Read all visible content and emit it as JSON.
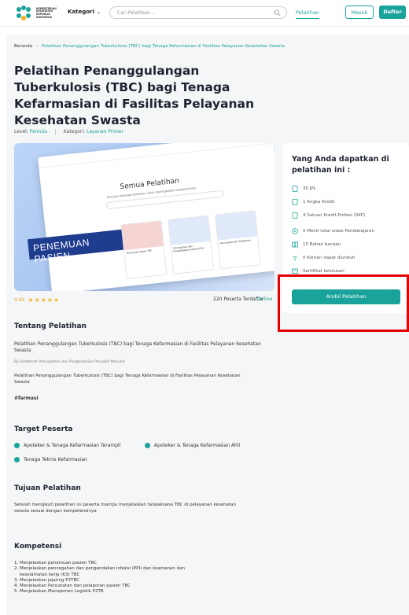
{
  "header": {
    "logo_text": "KEMENTERIAN KESEHATAN REPUBLIK INDONESIA",
    "kategori": "Kategori",
    "search_placeholder": "Cari Pelatihan...",
    "nav_pelatihan": "Pelatihan",
    "btn_masuk": "Masuk",
    "btn_daftar": "Daftar"
  },
  "breadcrumb": {
    "home": "Beranda",
    "sep": "›",
    "current": "Pelatihan Penanggulangan Tuberkulosis (TBC) bagi Tenaga Kefarmasian di Fasilitas Pelayanan Kesehatan Swasta"
  },
  "course": {
    "title": "Pelatihan Penanggulangan Tuberkulosis (TBC) bagi Tenaga Kefarmasian di Fasilitas Pelayanan Kesehatan Swasta",
    "level_label": "Level:",
    "level_value": "Pemula",
    "kategori_label": "Kategori:",
    "kategori_value": "Layanan Primer",
    "rating": "4.95",
    "stars": 4.95,
    "peserta": "220 Peserta Terdaftar",
    "mode": "Online"
  },
  "hero": {
    "screen_title": "Semua Pelatihan",
    "screen_sub": "Temukan berbagai pelatihan untuk meningkatkan kompetensimu",
    "banner": "PENEMUAN PASIEN",
    "cards": [
      "Penemuan Pasien TBC",
      "Pencegahan dan Pengendalian Infeksi (PPI)",
      "Pencatatan dan Pelaporan"
    ]
  },
  "side": {
    "heading": "Yang Anda dapatkan di pelatihan ini :",
    "items": [
      {
        "icon": "document-icon",
        "text": "30 JPL"
      },
      {
        "icon": "document-icon",
        "text": "1 Angka Kredit"
      },
      {
        "icon": "document-icon",
        "text": "4 Satuan Kredit Profesi (SKP)"
      },
      {
        "icon": "play-icon",
        "text": "0 Menit total video Pembelajaran"
      },
      {
        "icon": "book-icon",
        "text": "15 Bahan bacaan"
      },
      {
        "icon": "download-icon",
        "text": "0 Konten dapat diunduh"
      },
      {
        "icon": "certificate-icon",
        "text": "Sertifikat kelulusan"
      }
    ],
    "button": "Ambil Pelatihan"
  },
  "tentang": {
    "heading": "Tentang Pelatihan",
    "title": "Pelatihan Penanggulangan Tuberkulosis (TBC) bagi Tenaga Kefarmasian di Fasilitas Pelayanan Kesehatan Swasta",
    "by": "By Direktorat Pencegahan dan Pengendalian Penyakit Menular",
    "desc": "Pelatihan Penanggulangan Tuberkulosis (TBC) bagi Tenaga Kefarmasian di Fasilitas Pelayanan Kesehatan Swasta",
    "tag": "#farmasi"
  },
  "target": {
    "heading": "Target Peserta",
    "items": [
      "Apoteker & Tenaga Kefarmasian Terampil",
      "Apoteker & Tenaga Kefarmasian Ahli",
      "Tenaga Teknis Kefarmasian"
    ]
  },
  "tujuan": {
    "heading": "Tujuan Pelatihan",
    "text": "Setelah mengikuti pelatihan ini peserta mampu menjelaskan tatalaksana TBC di pelayanan kesehatan swasta sesuai dengan kompetensinya"
  },
  "kompetensi": {
    "heading": "Kompetensi",
    "items": [
      "1. Menjelaskan penemuan pasien TBC",
      "2. Menjelaskan pencegahan dan pengendalian infeksi (PPI) dan keamanan dan",
      "keselamatan kerja (K3) TBC",
      "3. Menjelaskan jejaring P2TBC",
      "4. Menjelaskan Pencatatan dan pelaporan pasien TBC",
      "5. Menjelaskan Manajemen Logistik P2TB"
    ]
  },
  "colors": {
    "accent": "#1aa39a",
    "highlight": "#e30000",
    "star": "#f5b82e"
  }
}
